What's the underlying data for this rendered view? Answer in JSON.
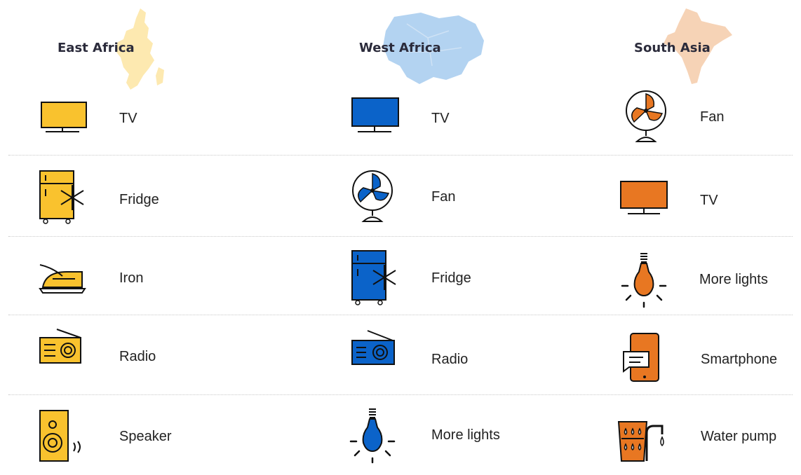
{
  "colors": {
    "east": "#f9c22e",
    "west": "#0b63c9",
    "south": "#e87722",
    "east_map": "#fde9b0",
    "west_map": "#b3d3f1",
    "south_map": "#f6d3b6"
  },
  "regions": [
    {
      "title": "East Africa",
      "key": "east",
      "items": [
        {
          "label": "TV",
          "icon": "tv-icon"
        },
        {
          "label": "Fridge",
          "icon": "fridge-icon"
        },
        {
          "label": "Iron",
          "icon": "iron-icon"
        },
        {
          "label": "Radio",
          "icon": "radio-icon"
        },
        {
          "label": "Speaker",
          "icon": "speaker-icon"
        }
      ]
    },
    {
      "title": "West Africa",
      "key": "west",
      "items": [
        {
          "label": "TV",
          "icon": "tv-icon"
        },
        {
          "label": "Fan",
          "icon": "fan-icon"
        },
        {
          "label": "Fridge",
          "icon": "fridge-icon"
        },
        {
          "label": "Radio",
          "icon": "radio-icon"
        },
        {
          "label": "More lights",
          "icon": "lightbulb-icon"
        }
      ]
    },
    {
      "title": "South Asia",
      "key": "south",
      "items": [
        {
          "label": "Fan",
          "icon": "fan-icon"
        },
        {
          "label": "TV",
          "icon": "tv-icon"
        },
        {
          "label": "More lights",
          "icon": "lightbulb-icon"
        },
        {
          "label": "Smartphone",
          "icon": "smartphone-icon"
        },
        {
          "label": "Water pump",
          "icon": "water-pump-icon"
        }
      ]
    }
  ]
}
